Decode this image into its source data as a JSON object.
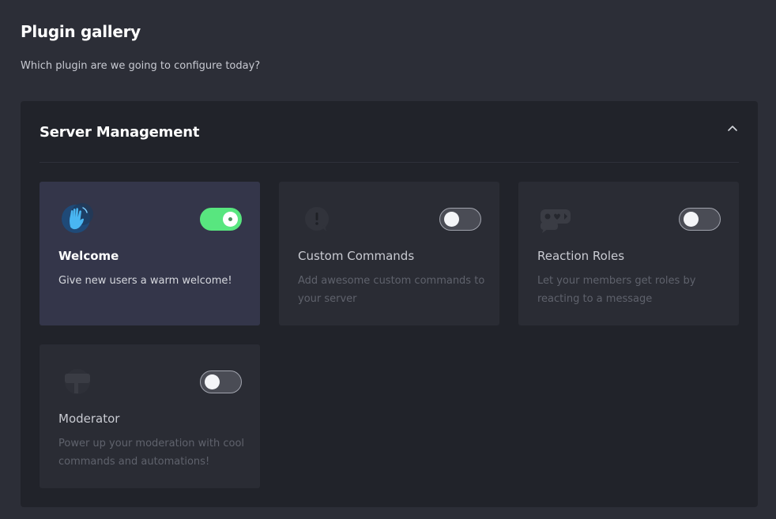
{
  "header": {
    "title": "Plugin gallery",
    "subtitle": "Which plugin are we going to configure today?"
  },
  "section": {
    "title": "Server Management",
    "collapse_icon": "chevron-up-icon"
  },
  "plugins": [
    {
      "title": "Welcome",
      "description": "Give new users a warm welcome!",
      "icon": "waving-hand-icon",
      "enabled": true
    },
    {
      "title": "Custom Commands",
      "description": "Add awesome custom commands to your server",
      "icon": "exclamation-bubble-icon",
      "enabled": false
    },
    {
      "title": "Reaction Roles",
      "description": "Let your members get roles by reacting to a message",
      "icon": "reaction-bubbles-icon",
      "enabled": false
    },
    {
      "title": "Moderator",
      "description": "Power up your moderation with cool commands and automations!",
      "icon": "gavel-icon",
      "enabled": false
    }
  ],
  "colors": {
    "background": "#2c2e37",
    "panel": "#21232a",
    "card": "#2a2c34",
    "card_active": "#34364a",
    "toggle_on": "#58e67f"
  }
}
